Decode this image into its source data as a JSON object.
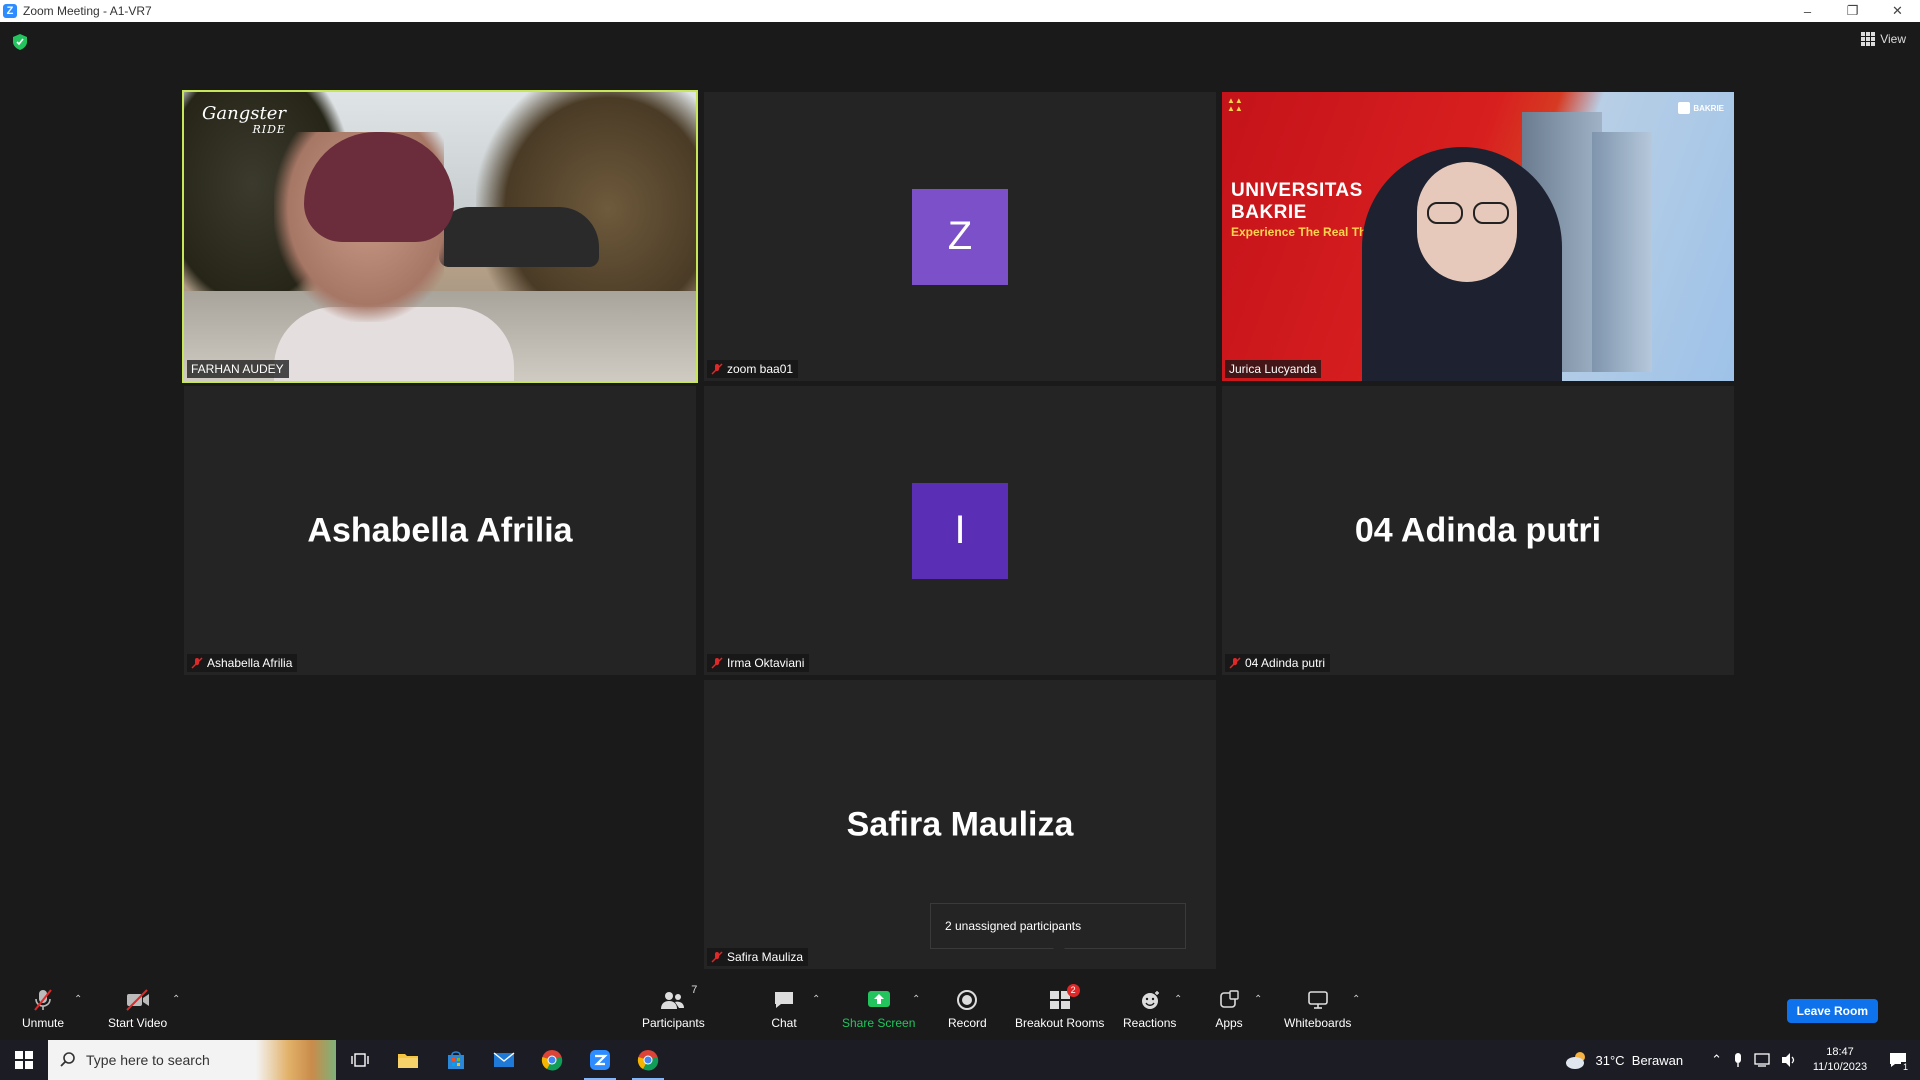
{
  "window": {
    "title": "Zoom Meeting - A1-VR7"
  },
  "header": {
    "view_label": "View"
  },
  "tiles": [
    {
      "name": "FARHAN AUDEY",
      "type": "video",
      "muted": false,
      "speaking": true,
      "video_logo": "Gangster",
      "video_logo2": "RIDE"
    },
    {
      "name": "zoom baa01",
      "type": "avatar",
      "initial": "Z",
      "avatar_color": "#7b50c8",
      "muted": true
    },
    {
      "name": "Jurica Lucyanda",
      "type": "video",
      "muted": false,
      "slide_title_1": "UNIVERSITAS",
      "slide_title_2": "BAKRIE",
      "slide_tagline": "Experience The Real Things",
      "slide_brand": "BAKRIE"
    },
    {
      "name": "Ashabella Afrilia",
      "type": "name",
      "display_name": "Ashabella Afrilia",
      "muted": true
    },
    {
      "name": "Irma Oktaviani",
      "type": "avatar",
      "initial": "I",
      "avatar_color": "#5b2fb5",
      "muted": true
    },
    {
      "name": "04 Adinda putri",
      "type": "name",
      "display_name": "04 Adinda putri",
      "muted": true
    },
    {
      "name": "Safira Mauliza",
      "type": "name",
      "display_name": "Safira Mauliza",
      "muted": true
    }
  ],
  "tooltip": {
    "text": "2 unassigned participants"
  },
  "controls": {
    "unmute": "Unmute",
    "start_video": "Start Video",
    "participants": "Participants",
    "participants_count": "7",
    "chat": "Chat",
    "share_screen": "Share Screen",
    "record": "Record",
    "breakout_rooms": "Breakout Rooms",
    "breakout_badge": "2",
    "reactions": "Reactions",
    "apps": "Apps",
    "whiteboards": "Whiteboards",
    "leave": "Leave Room"
  },
  "taskbar": {
    "search_placeholder": "Type here to search",
    "weather": "31°C  Berawan",
    "time": "18:47",
    "date": "11/10/2023",
    "notification_count": "1"
  },
  "colors": {
    "accent": "#0e72ed",
    "share_green": "#23c45e",
    "speaking_border": "#c8e65a",
    "muted_red": "#e02828"
  }
}
